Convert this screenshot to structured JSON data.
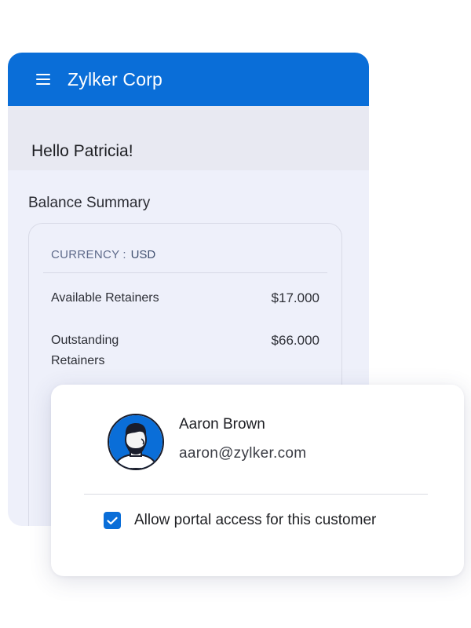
{
  "app": {
    "title": "Zylker Corp",
    "greeting": "Hello Patricia!",
    "colors": {
      "accent": "#0a6ed8",
      "background": "#eef0fa"
    }
  },
  "balance_summary": {
    "title": "Balance Summary",
    "currency_label": "CURRENCY",
    "currency_separator": ":",
    "currency_value": "USD",
    "rows": [
      {
        "label": "Available Retainers",
        "value": "$17.000"
      },
      {
        "label": "Outstanding Retainers",
        "value": "$66.000"
      }
    ]
  },
  "customer": {
    "name": "Aaron Brown",
    "email": "aaron@zylker.com",
    "avatar_icon": "user-avatar-icon",
    "portal_access": {
      "label": "Allow portal access for this customer",
      "checked": true
    }
  }
}
